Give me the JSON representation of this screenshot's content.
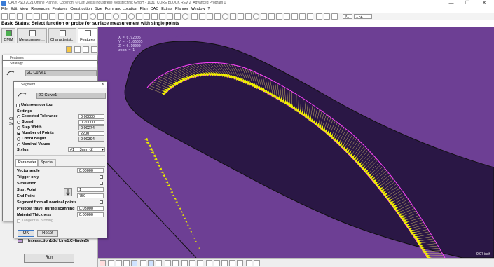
{
  "window": {
    "title": "CALYPSO 2021 Offline Planner, Copyright © Carl Zeiss Industrielle Messtechnik GmbH - 1031_CORE BLOCK REV 2_Advanced Program 1",
    "min": "—",
    "max": "☐",
    "close": "✕"
  },
  "menu": [
    "File",
    "Edit",
    "View",
    "Resources",
    "Features",
    "Construction",
    "Size",
    "Form and Location",
    "Plan",
    "CAD",
    "Extras",
    "Planner",
    "Window",
    "?"
  ],
  "toolbar": {
    "stylus_select": "#1",
    "stylus_dir": "1 -Z"
  },
  "status": {
    "text": "Basic Status: Select function or probe for surface measurement with single points"
  },
  "tabs": [
    {
      "label": "CMM",
      "icon": "cmm-icon"
    },
    {
      "label": "Measuremen...",
      "icon": "measurement-icon"
    },
    {
      "label": "Characterist...",
      "icon": "characteristic-icon"
    },
    {
      "label": "Features",
      "icon": "features-icon"
    }
  ],
  "left": {
    "feature_tree_last": "Intersection1(2d Line1,Cylinder5)",
    "run_label": "Run",
    "partial_labels": [
      "Ch",
      "Se"
    ]
  },
  "features_window": {
    "title": "Features"
  },
  "strategy_window": {
    "title": "Strategy",
    "item": "2D Curve1"
  },
  "segment": {
    "title": "Segment",
    "feature_name": "2D Curve1",
    "unknown_contour": "Unknown contour",
    "settings_label": "Settings",
    "settings": [
      {
        "label": "Expected Tolerance",
        "value": "0.00000",
        "selected": false,
        "readonly": false
      },
      {
        "label": "Speed",
        "value": "0.20000",
        "selected": false,
        "readonly": false
      },
      {
        "label": "Step Width",
        "value": "0.00274",
        "selected": false,
        "readonly": true
      },
      {
        "label": "Number of Points",
        "value": "2200",
        "selected": true,
        "readonly": false
      },
      {
        "label": "Chord height",
        "value": "0.00394",
        "selected": false,
        "readonly": true
      },
      {
        "label": "Nominal Values",
        "value": "",
        "selected": false,
        "readonly": false
      }
    ],
    "stylus_label": "Stylus",
    "stylus_num": "#1",
    "stylus_dir": "3mm -Z",
    "tab_parameter": "Parameter",
    "tab_special": "Special",
    "vector_angle_label": "Vector angle",
    "vector_angle": "0.00000",
    "trigger_only": "Trigger only",
    "simulation": "Simulation",
    "start_point_label": "Start Point",
    "start_point": "1",
    "end_point_label": "End Point",
    "end_point": "750",
    "segment_all": "Segment from all nominal points",
    "prepost_label": "Pre/post travel during scanning",
    "prepost": "0.03000",
    "material_label": "Material Thickness",
    "material": "0.00000",
    "tangential": "Tangential probing",
    "ok": "OK",
    "reset": "Reset"
  },
  "graphic": {
    "coords": [
      "X = 0.92006",
      "Y = -1.06005",
      "Z = 0.10000",
      "zoom = 1"
    ],
    "scale": "0.07 inch",
    "colors": {
      "background": "#6d3f94",
      "part": "#2a1745",
      "path": "#ff40ff",
      "points": "#f2f200",
      "edge": "#101010"
    }
  }
}
